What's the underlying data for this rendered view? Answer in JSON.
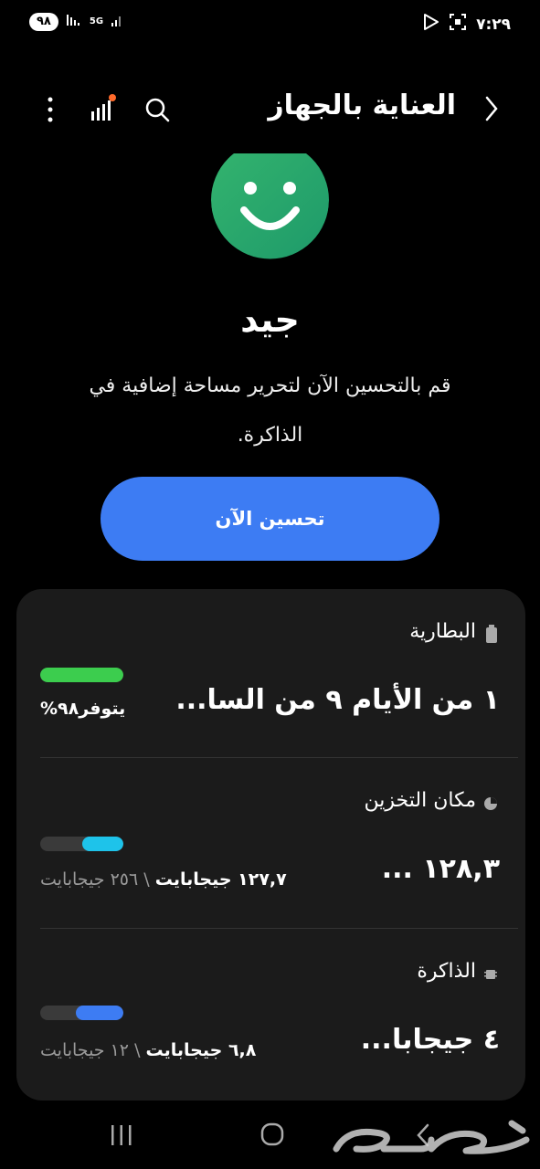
{
  "status_bar": {
    "battery": "٩٨",
    "network": "5G",
    "time": "٧:٢٩",
    "icons": [
      "signal-icon",
      "5g-icon",
      "play-store-icon",
      "screenshot-icon"
    ]
  },
  "header": {
    "title": "العناية بالجهاز",
    "icons": [
      "back-chevron-icon",
      "search-icon",
      "diagnostics-chart-icon",
      "more-options-icon"
    ]
  },
  "hero": {
    "face_icon": "smiley-face-icon",
    "status_word": "جيد",
    "description": "قم بالتحسين الآن لتحرير مساحة إضافية في الذاكرة.",
    "button_label": "تحسين الآن"
  },
  "colors": {
    "face_green": "#2aa86a",
    "button_blue": "#3d7cf3",
    "battery_green": "#3ccd4e",
    "storage_cyan": "#1ec3ea",
    "memory_blue": "#3d7cf3",
    "card_bg": "#1b1b1b"
  },
  "battery": {
    "label": "البطارية",
    "icon": "battery-icon",
    "main": "١ من الأيام ٩ من السا...",
    "available": "يتوفر٩٨%",
    "level": 1.0
  },
  "storage": {
    "label": "مكان التخزين",
    "icon": "pie-chart-icon",
    "main": "١٢٨,٣ ...",
    "used": "١٢٧,٧ جيجابايت",
    "total": "٢٥٦ جيجابايت",
    "separator": "\\",
    "level": 0.5
  },
  "memory": {
    "label": "الذاكرة",
    "icon": "memory-chip-icon",
    "main": "٤ جيجابا...",
    "used": "٦,٨ جيجابايت",
    "total": "١٢ جيجابايت",
    "separator": "\\",
    "level": 0.57
  },
  "nav_bar": {
    "icons": [
      "recent-apps-icon",
      "home-icon",
      "back-icon"
    ]
  },
  "watermark": {
    "text": "حراج"
  }
}
